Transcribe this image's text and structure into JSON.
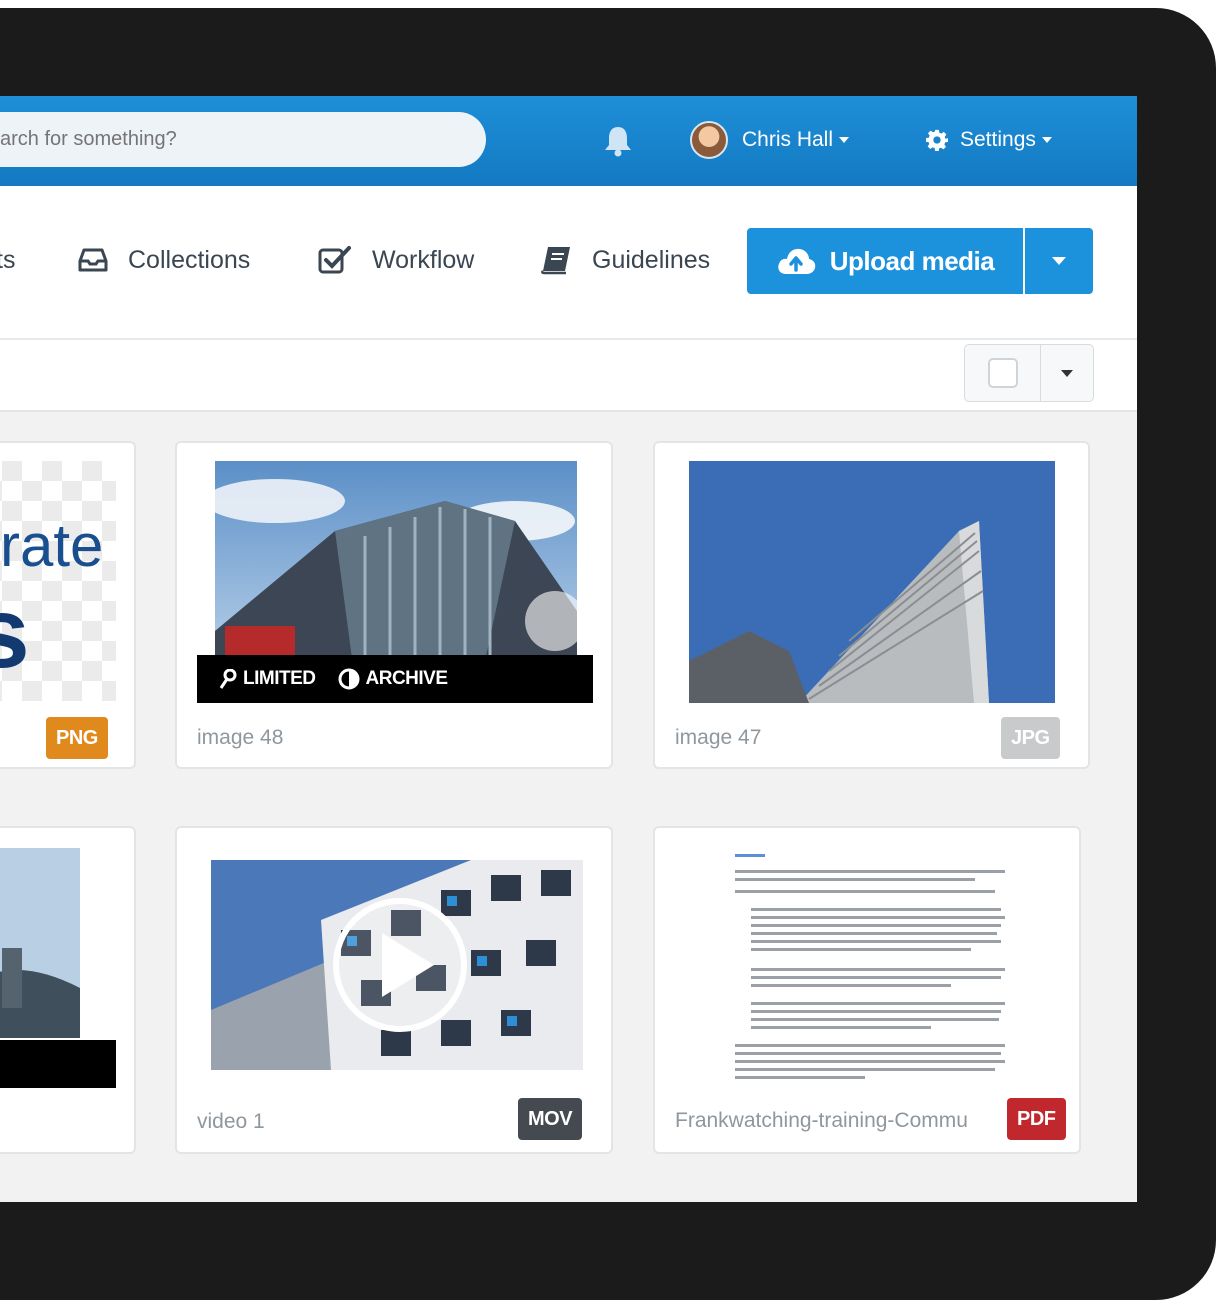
{
  "topbar": {
    "search_placeholder": "arch for something?",
    "user_name": "Chris Hall",
    "settings_label": "Settings"
  },
  "nav": {
    "partial_label": "ts",
    "collections_label": "Collections",
    "workflow_label": "Workflow",
    "guidelines_label": "Guidelines",
    "upload_label": "Upload media"
  },
  "cards": [
    {
      "name": "",
      "badge": "PNG",
      "badge_color": "#e08a1e",
      "partial_text_1": "rate",
      "partial_text_2": "s"
    },
    {
      "name": "image 48",
      "badge": "",
      "overlay": [
        "LIMITED",
        "ARCHIVE"
      ]
    },
    {
      "name": "image 47",
      "badge": "JPG",
      "badge_color": "#c8cacc"
    },
    {
      "name": "",
      "badge": ""
    },
    {
      "name": "video 1",
      "badge": "MOV",
      "badge_color": "#444a4f"
    },
    {
      "name": "Frankwatching-training-Commu",
      "badge": "PDF",
      "badge_color": "#c0282d"
    }
  ],
  "colors": {
    "topbar": "#1379c2",
    "primary_button": "#1c92dc",
    "bezel": "#1b1b1b"
  },
  "icons": {
    "bell": "bell-icon",
    "settings": "gear-icon",
    "collections": "inbox-icon",
    "workflow": "check-square-icon",
    "guidelines": "book-icon",
    "upload": "cloud-upload-icon",
    "limited": "key-icon",
    "archive": "contrast-icon",
    "play": "play-icon"
  }
}
